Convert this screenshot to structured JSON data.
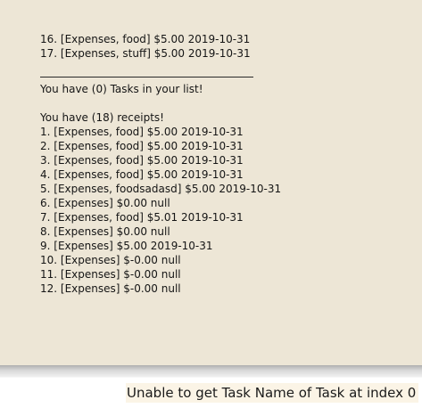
{
  "output": {
    "top_lines": [
      "16. [Expenses, food] $5.00 2019-10-31",
      "17. [Expenses, stuff] $5.00 2019-10-31"
    ],
    "tasks_summary": "You have (0) Tasks in your list!",
    "receipts_header": "You have (18) receipts!",
    "receipts": [
      "1. [Expenses, food] $5.00 2019-10-31",
      "2. [Expenses, food] $5.00 2019-10-31",
      "3. [Expenses, food] $5.00 2019-10-31",
      "4. [Expenses, food] $5.00 2019-10-31",
      "5. [Expenses, foodsadasd] $5.00 2019-10-31",
      "6. [Expenses] $0.00 null",
      "7. [Expenses, food] $5.01 2019-10-31",
      "8. [Expenses] $0.00 null",
      "9. [Expenses] $5.00 2019-10-31",
      "10. [Expenses] $-0.00 null",
      "11. [Expenses] $-0.00 null",
      "12. [Expenses] $-0.00 null"
    ]
  },
  "status": {
    "message": "Unable to get Task Name of Task at index 0"
  }
}
